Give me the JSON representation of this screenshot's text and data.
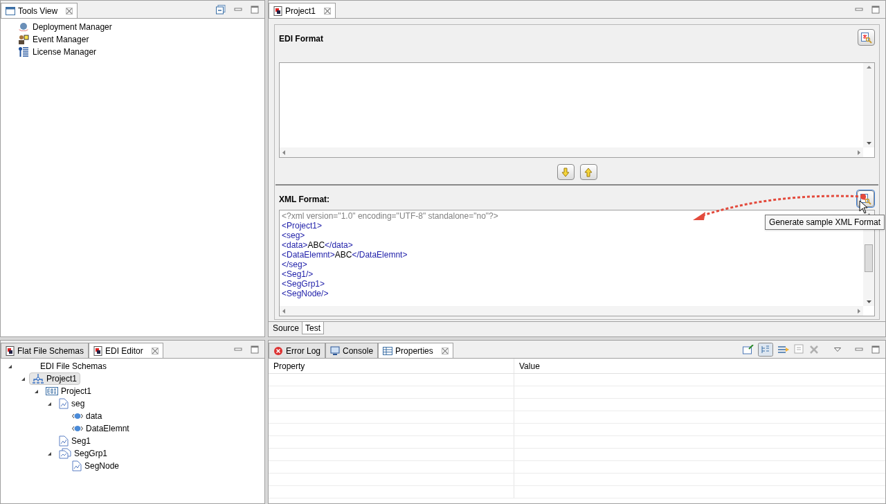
{
  "tools_view": {
    "tabs": [
      {
        "title": "Tools View",
        "selected": true,
        "closable": true
      }
    ],
    "items": [
      {
        "label": "Deployment Manager",
        "kind": "deploy"
      },
      {
        "label": "Event Manager",
        "kind": "event"
      },
      {
        "label": "License Manager",
        "kind": "license"
      }
    ]
  },
  "editor": {
    "tabs": [
      {
        "title": "Project1",
        "selected": true,
        "closable": true
      }
    ],
    "edi_format": {
      "title": "EDI Format"
    },
    "xml_format": {
      "title": "XML Format:",
      "lines": [
        [
          {
            "kind": "decl",
            "text": "<?xml version=\"1.0\" encoding=\"UTF-8\" standalone=\"no\"?>"
          }
        ],
        [
          {
            "kind": "tag",
            "text": "<Project1>"
          }
        ],
        [
          {
            "kind": "tag",
            "text": "<seg>"
          }
        ],
        [
          {
            "kind": "tag",
            "text": "<data>"
          },
          {
            "kind": "text",
            "text": "ABC"
          },
          {
            "kind": "tag",
            "text": "</data>"
          }
        ],
        [
          {
            "kind": "tag",
            "text": "<DataElemnt>"
          },
          {
            "kind": "text",
            "text": "ABC"
          },
          {
            "kind": "tag",
            "text": "</DataElemnt>"
          }
        ],
        [
          {
            "kind": "tag",
            "text": "</seg>"
          }
        ],
        [
          {
            "kind": "tag",
            "text": "<Seg1/>"
          }
        ],
        [
          {
            "kind": "tag",
            "text": "<SegGrp1>"
          }
        ],
        [
          {
            "kind": "tag",
            "text": "<SegNode/>"
          }
        ]
      ]
    },
    "tooltip": "Generate sample XML Format",
    "bottom_tabs": [
      {
        "title": "Source",
        "selected": false
      },
      {
        "title": "Test",
        "selected": true
      }
    ]
  },
  "schemas": {
    "tabs": [
      {
        "title": "Flat File Schemas",
        "selected": false,
        "closable": false
      },
      {
        "title": "EDI Editor",
        "selected": true,
        "closable": true
      }
    ],
    "tree": [
      {
        "label": "EDI File Schemas",
        "kind": "root",
        "expanded": true,
        "selected": false,
        "children": [
          {
            "label": "Project1",
            "kind": "project",
            "expanded": true,
            "selected": true,
            "children": [
              {
                "label": "Project1",
                "kind": "edi",
                "expanded": true,
                "selected": false,
                "children": [
                  {
                    "label": "seg",
                    "kind": "segment",
                    "expanded": true,
                    "selected": false,
                    "children": [
                      {
                        "label": "data",
                        "kind": "element",
                        "selected": false
                      },
                      {
                        "label": "DataElemnt",
                        "kind": "element",
                        "selected": false
                      }
                    ]
                  },
                  {
                    "label": "Seg1",
                    "kind": "segment",
                    "selected": false
                  },
                  {
                    "label": "SegGrp1",
                    "kind": "group",
                    "expanded": true,
                    "selected": false,
                    "children": [
                      {
                        "label": "SegNode",
                        "kind": "segment",
                        "selected": false
                      }
                    ]
                  }
                ]
              }
            ]
          }
        ]
      }
    ]
  },
  "properties": {
    "tabs": [
      {
        "title": "Error Log",
        "selected": false,
        "closable": false,
        "kind": "error"
      },
      {
        "title": "Console",
        "selected": false,
        "closable": false,
        "kind": "console"
      },
      {
        "title": "Properties",
        "selected": true,
        "closable": true,
        "kind": "table"
      }
    ],
    "columns": [
      "Property",
      "Value"
    ]
  }
}
